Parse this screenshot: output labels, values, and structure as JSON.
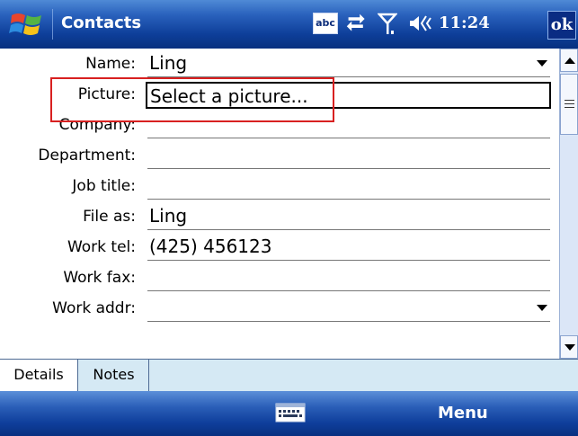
{
  "titlebar": {
    "app_title": "Contacts",
    "abc_label": "abc",
    "clock": "11:24",
    "ok_label": "ok"
  },
  "form": {
    "fields": [
      {
        "label": "Name:",
        "value": "Ling",
        "dropdown": true
      },
      {
        "label": "Picture:",
        "value": "Select a picture..."
      },
      {
        "label": "Company:",
        "value": ""
      },
      {
        "label": "Department:",
        "value": ""
      },
      {
        "label": "Job title:",
        "value": ""
      },
      {
        "label": "File as:",
        "value": "Ling"
      },
      {
        "label": "Work tel:",
        "value": "(425) 456123"
      },
      {
        "label": "Work fax:",
        "value": ""
      },
      {
        "label": "Work addr:",
        "value": "",
        "dropdown": true
      }
    ]
  },
  "tabs": [
    {
      "label": "Details",
      "selected": true
    },
    {
      "label": "Notes",
      "selected": false
    }
  ],
  "menubar": {
    "keyboard_icon": "keyboard-icon",
    "menu_label": "Menu"
  },
  "colors": {
    "titlebar_blue": "#0e3f9a",
    "highlight_red": "#d82020",
    "tab_bg": "#d5e9f4"
  }
}
